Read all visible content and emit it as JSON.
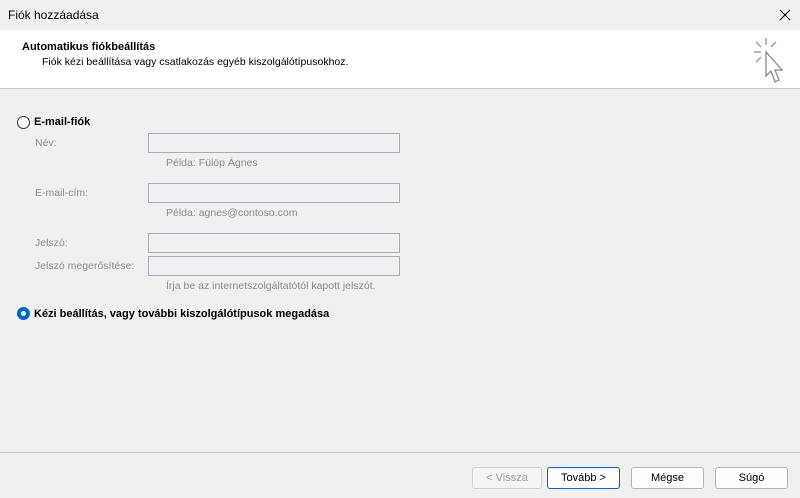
{
  "window": {
    "title": "Fiók hozzáadása"
  },
  "header": {
    "title": "Automatikus fiókbeállítás",
    "subtitle": "Fiók kézi beállítása vagy csatlakozás egyéb kiszolgálótípusokhoz."
  },
  "options": {
    "email_account": {
      "label": "E-mail-fiók",
      "selected": false
    },
    "manual_setup": {
      "label": "Kézi beállítás, vagy további kiszolgálótípusok megadása",
      "selected": true
    }
  },
  "form": {
    "name_label": "Név:",
    "name_value": "",
    "name_hint": "Példa: Fülöp Ágnes",
    "email_label": "E-mail-cím:",
    "email_value": "",
    "email_hint": "Példa: agnes@contoso.com",
    "password_label": "Jelszó:",
    "password_value": "",
    "confirm_label": "Jelszó megerősítése:",
    "confirm_value": "",
    "password_hint": "Írja be az internetszolgáltatótól kapott jelszót."
  },
  "buttons": {
    "back": "< Vissza",
    "next": "Tovább >",
    "cancel": "Mégse",
    "help": "Súgó"
  },
  "colors": {
    "accent": "#0067c0",
    "background": "#f0f0f0"
  }
}
